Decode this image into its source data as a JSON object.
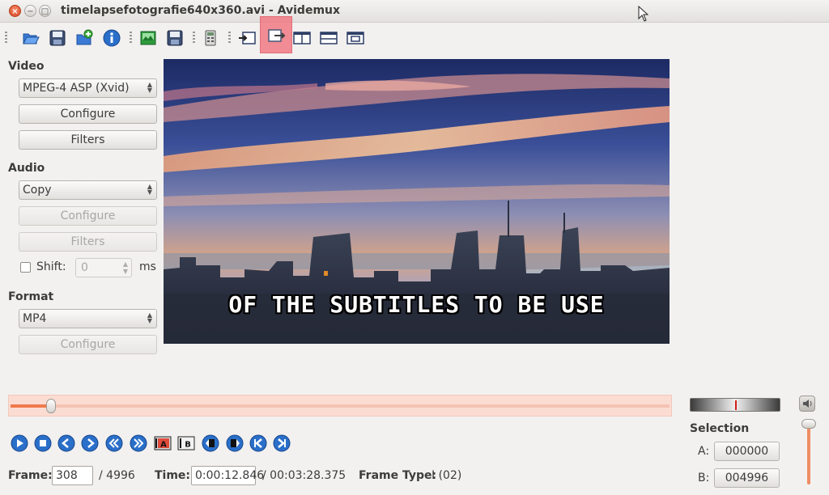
{
  "window": {
    "title": "timelapsefotografie640x360.avi - Avidemux"
  },
  "toolbar": {
    "icons": [
      "open-icon",
      "save-icon",
      "append-icon",
      "info-icon",
      "save-image-icon",
      "save-video-icon",
      "calculator-icon",
      "input-preview-icon",
      "output-preview-icon",
      "side-by-side-icon",
      "top-bottom-icon",
      "separate-window-icon"
    ],
    "active_index": 8
  },
  "video_section": {
    "label": "Video",
    "codec": "MPEG-4 ASP (Xvid)",
    "configure_label": "Configure",
    "filters_label": "Filters"
  },
  "audio_section": {
    "label": "Audio",
    "codec": "Copy",
    "configure_label": "Configure",
    "filters_label": "Filters",
    "shift_label": "Shift:",
    "shift_value": "0",
    "shift_unit": "ms",
    "shift_checked": false
  },
  "format_section": {
    "label": "Format",
    "container": "MP4",
    "configure_label": "Configure"
  },
  "preview": {
    "subtitle": "OF THE SUBTITLES TO BE USE"
  },
  "timeline": {
    "position_fraction": 0.0617
  },
  "status": {
    "frame_label": "Frame:",
    "frame_value": "308",
    "frame_total": "/ 4996",
    "time_label": "Time:",
    "time_value": "0:00:12.846",
    "time_total": "/ 00:03:28.375",
    "frame_type_label": "Frame Type:",
    "frame_type_value": "I (02)"
  },
  "selection": {
    "title": "Selection",
    "a_label": "A:",
    "a_value": "000000",
    "b_label": "B:",
    "b_value": "004996"
  },
  "colors": {
    "accent_orange": "#f07a4e",
    "active_highlight": "#f17a85",
    "play_blue": "#2a6fc9"
  }
}
